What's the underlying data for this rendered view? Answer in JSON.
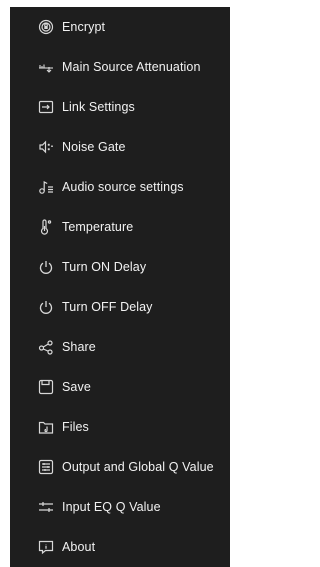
{
  "menu": {
    "items": [
      {
        "label": "Encrypt",
        "icon": "encrypt-icon"
      },
      {
        "label": "Main Source Attenuation",
        "icon": "attenuation-icon"
      },
      {
        "label": "Link Settings",
        "icon": "link-settings-icon"
      },
      {
        "label": "Noise Gate",
        "icon": "noise-gate-icon"
      },
      {
        "label": "Audio source settings",
        "icon": "audio-source-icon"
      },
      {
        "label": "Temperature",
        "icon": "temperature-icon"
      },
      {
        "label": "Turn ON Delay",
        "icon": "power-icon"
      },
      {
        "label": "Turn OFF Delay",
        "icon": "power-icon"
      },
      {
        "label": "Share",
        "icon": "share-icon"
      },
      {
        "label": "Save",
        "icon": "save-icon"
      },
      {
        "label": "Files",
        "icon": "files-icon"
      },
      {
        "label": "Output and Global Q Value",
        "icon": "output-q-icon"
      },
      {
        "label": "Input EQ Q Value",
        "icon": "input-eq-icon"
      },
      {
        "label": "About",
        "icon": "about-icon"
      }
    ]
  },
  "colors": {
    "panel_background": "#1e1e1e",
    "text": "#f2f2f2",
    "icon": "#d8d8d8"
  }
}
